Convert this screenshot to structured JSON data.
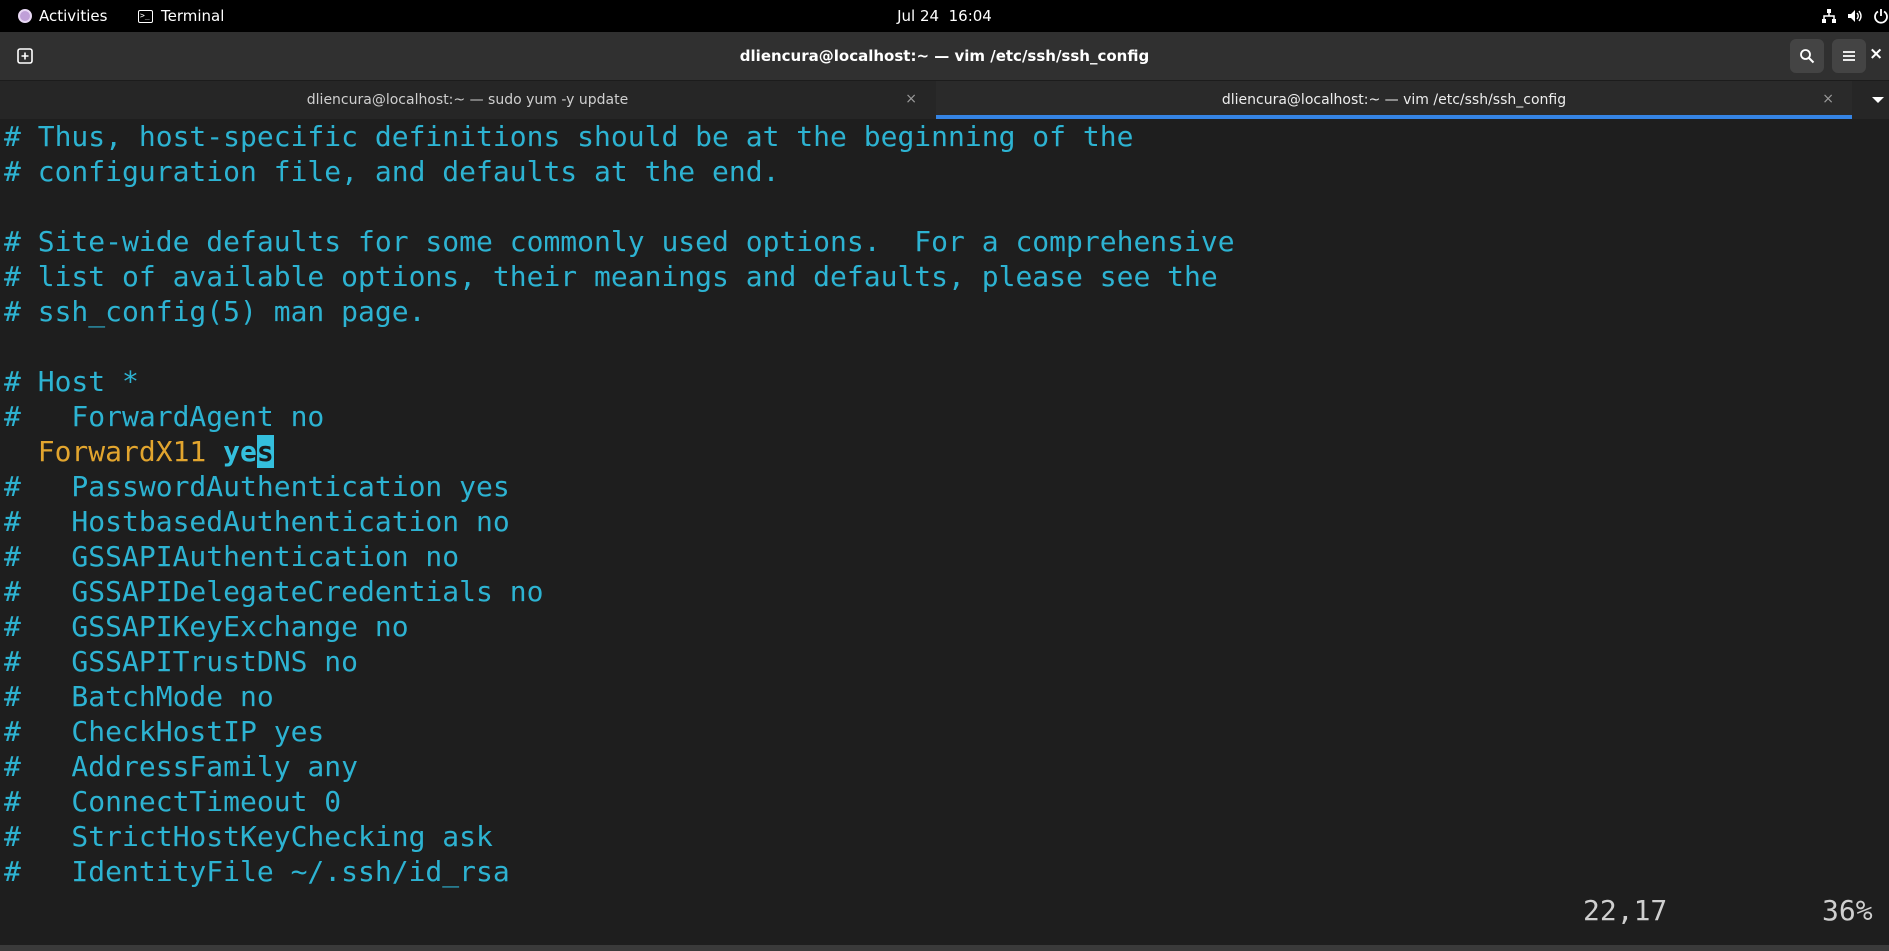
{
  "topbar": {
    "activities": "Activities",
    "app_name": "Terminal",
    "date": "Jul 24",
    "time": "16:04",
    "tray_icons": [
      "network-icon",
      "volume-icon",
      "power-icon"
    ]
  },
  "window": {
    "title": "dliencura@localhost:~ — vim /etc/ssh/ssh_config",
    "close_glyph": "×"
  },
  "tabs": [
    {
      "label": "dliencura@localhost:~ — sudo yum -y update",
      "close": "×",
      "active": false
    },
    {
      "label": "dliencura@localhost:~ — vim /etc/ssh/ssh_config",
      "close": "×",
      "active": true
    }
  ],
  "editor": {
    "lines": [
      "# Thus, host-specific definitions should be at the beginning of the",
      "# configuration file, and defaults at the end.",
      "",
      "# Site-wide defaults for some commonly used options.  For a comprehensive",
      "# list of available options, their meanings and defaults, please see the",
      "# ssh_config(5) man page.",
      "",
      "# Host *",
      "#   ForwardAgent no",
      "",
      "#   PasswordAuthentication yes",
      "#   HostbasedAuthentication no",
      "#   GSSAPIAuthentication no",
      "#   GSSAPIDelegateCredentials no",
      "#   GSSAPIKeyExchange no",
      "#   GSSAPITrustDNS no",
      "#   BatchMode no",
      "#   CheckHostIP yes",
      "#   AddressFamily any",
      "#   ConnectTimeout 0",
      "#   StrictHostKeyChecking ask",
      "#   IdentityFile ~/.ssh/id_rsa"
    ],
    "active_line": {
      "indent": "  ",
      "keyword": "ForwardX11",
      "space": " ",
      "value_before_cursor": "ye",
      "cursor_char": "s"
    },
    "cursor_position": "22,17",
    "scroll_percent": "36%"
  },
  "colors": {
    "comment": "#2db3d2",
    "keyword": "#e2a52e",
    "value": "#34bfdd",
    "accent": "#3584e4",
    "background": "#1e1e1e"
  }
}
